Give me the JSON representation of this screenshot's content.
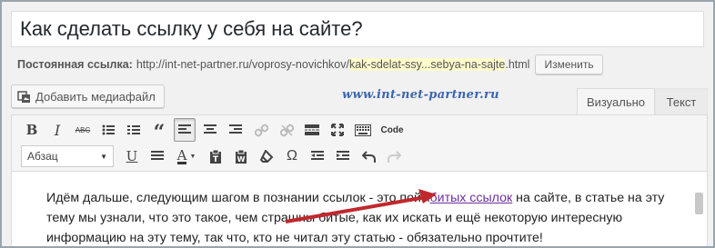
{
  "title_field": {
    "value": "Как сделать ссылку у себя на сайте?"
  },
  "permalink": {
    "label": "Постоянная ссылка:",
    "url_prefix": "http://int-net-partner.ru/voprosy-novichkov/",
    "slug": "kak-sdelat-ssy...sebya-na-sajte",
    "suffix": ".html",
    "edit_button": "Изменить"
  },
  "media_button": {
    "label": "Добавить медиафайл",
    "icon": "media-add-icon"
  },
  "watermark": "www.int-net-partner.ru",
  "tabs": [
    {
      "label": "Визуально",
      "active": true
    },
    {
      "label": "Текст",
      "active": false
    }
  ],
  "toolbar": {
    "row1": [
      {
        "name": "bold-icon",
        "glyph": "B"
      },
      {
        "name": "italic-icon",
        "glyph": "I"
      },
      {
        "name": "strikethrough-icon",
        "glyph": "ABC"
      },
      {
        "name": "bullet-list-icon",
        "glyph": "ul"
      },
      {
        "name": "numbered-list-icon",
        "glyph": "ol"
      },
      {
        "name": "blockquote-icon",
        "glyph": "“"
      },
      {
        "name": "align-left-icon",
        "glyph": "al",
        "active": true
      },
      {
        "name": "align-center-icon",
        "glyph": "ac"
      },
      {
        "name": "align-right-icon",
        "glyph": "ar"
      },
      {
        "name": "insert-link-icon",
        "glyph": "link",
        "dim": true
      },
      {
        "name": "remove-link-icon",
        "glyph": "unlink",
        "dim": true
      },
      {
        "name": "read-more-icon",
        "glyph": "more"
      },
      {
        "name": "fullscreen-icon",
        "glyph": "fs"
      },
      {
        "name": "toolbar-toggle-icon",
        "glyph": "kb"
      }
    ],
    "code_label": "Code",
    "format_select": "Абзац",
    "row2": [
      {
        "name": "underline-icon",
        "glyph": "U"
      },
      {
        "name": "justify-icon",
        "glyph": "jf"
      },
      {
        "name": "text-color-icon",
        "glyph": "A"
      },
      {
        "name": "paste-as-text-icon",
        "glyph": "pt"
      },
      {
        "name": "clear-formatting-icon",
        "glyph": "cf"
      },
      {
        "name": "eraser-icon",
        "glyph": "er"
      },
      {
        "name": "special-character-icon",
        "glyph": "Ω"
      },
      {
        "name": "outdent-icon",
        "glyph": "od"
      },
      {
        "name": "indent-icon",
        "glyph": "id"
      },
      {
        "name": "undo-icon",
        "glyph": "un"
      },
      {
        "name": "redo-icon",
        "glyph": "re",
        "dim": true
      }
    ]
  },
  "content": {
    "line1_before": "Идём дальше, следующим шагом в познании ссылок - это пойм",
    "line1_link": "битых ссылок",
    "line1_after": " на сайте, в статье на эту",
    "line2": "тему мы узнали, что это такое, чем страшны битые, как их искать и ещё некоторую интересную",
    "line3": "информацию на эту тему, так что, кто не читал эту статью - обязательно прочтите!"
  },
  "colors": {
    "accent_arrow": "#c0282d",
    "link": "#6b2fa0",
    "slug_highlight": "#fffbcc",
    "watermark": "#3b66b0"
  }
}
